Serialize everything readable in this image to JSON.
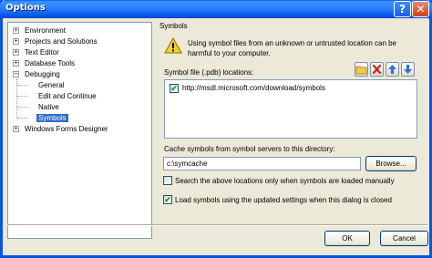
{
  "window": {
    "title": "Options",
    "help_glyph": "?",
    "close_glyph": "✕"
  },
  "tree": {
    "items": [
      {
        "label": "Environment",
        "expander": "+"
      },
      {
        "label": "Projects and Solutions",
        "expander": "+"
      },
      {
        "label": "Text Editor",
        "expander": "+"
      },
      {
        "label": "Database Tools",
        "expander": "+"
      },
      {
        "label": "Debugging",
        "expander": "−"
      },
      {
        "label": "General"
      },
      {
        "label": "Edit and Continue"
      },
      {
        "label": "Native"
      },
      {
        "label": "Symbols",
        "selected": true
      },
      {
        "label": "Windows Forms Designer",
        "expander": "+"
      }
    ]
  },
  "page": {
    "heading": "Symbols",
    "warning": "Using symbol files from an unknown or untrusted location can be harmful to your computer.",
    "locations_label": "Symbol file (.pdb) locations:",
    "locations": [
      {
        "checked": true,
        "path": "http://msdl.microsoft.com/download/symbols"
      }
    ],
    "toolbar_icons": [
      "folder-icon",
      "delete-icon",
      "move-up-icon",
      "move-down-icon"
    ],
    "cache_label": "Cache symbols from symbol servers to this directory:",
    "cache_value": "c:\\symcache",
    "browse_label": "Browse...",
    "option_search_manual": {
      "checked": false,
      "label": "Search the above locations only when symbols are loaded manually"
    },
    "option_load_updated": {
      "checked": true,
      "label": "Load symbols using the updated settings when this dialog is closed"
    }
  },
  "buttons": {
    "ok": "OK",
    "cancel": "Cancel"
  },
  "colors": {
    "title_bar": "#0a54e3",
    "dialog_bg": "#ece9d8",
    "selection": "#316ac5",
    "check_mark": "#21a121"
  }
}
